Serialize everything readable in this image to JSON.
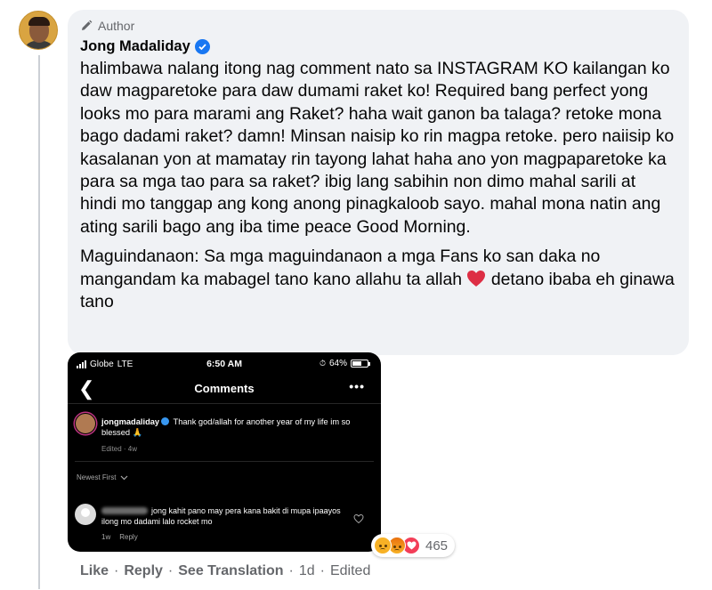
{
  "comment": {
    "badge": "Author",
    "author": "Jong Madaliday",
    "paragraphs": [
      "halimbawa nalang itong nag comment nato sa INSTAGRAM KO kailangan ko daw magparetoke para daw dumami raket ko! Required bang perfect yong looks mo para marami ang Raket? haha wait ganon ba talaga? retoke mona bago dadami raket? damn! Minsan naisip ko rin magpa retoke. pero naiisip ko kasalanan yon at mamatay rin tayong lahat haha ano yon magpaparetoke ka para sa mga tao para sa raket? ibig lang sabihin non dimo mahal sarili at hindi mo tanggap ang kong anong pinagkaloob sayo. mahal mona natin ang ating sarili bago ang iba time peace Good Morning."
    ],
    "p2_before": "Maguindanaon: Sa mga maguindanaon a mga Fans ko san daka no mangandam ka mabagel tano kano allahu ta allah",
    "p2_after": "detano ibaba eh ginawa tano",
    "reaction_count": "465",
    "actions": {
      "like": "Like",
      "reply": "Reply",
      "translate": "See Translation",
      "time": "1d",
      "edited": "Edited"
    }
  },
  "screenshot": {
    "carrier": "Globe",
    "network": "LTE",
    "time": "6:50 AM",
    "battery": "64%",
    "battery_level": 0.64,
    "title": "Comments",
    "caption_user": "jongmadaliday",
    "caption_text": "Thank god/allah for another year of my life im so blessed 🙏",
    "caption_meta": "Edited · 4w",
    "sort_label": "Newest First",
    "comment_text": "jong kahit pano may pera kana bakit di mupa ipaayos ilong mo dadami lalo rocket mo",
    "comment_age": "1w",
    "comment_reply": "Reply"
  },
  "colors": {
    "bubble": "#f0f2f5",
    "verified": "#1877f2",
    "muted": "#65676b",
    "heart": "#e0245e"
  }
}
